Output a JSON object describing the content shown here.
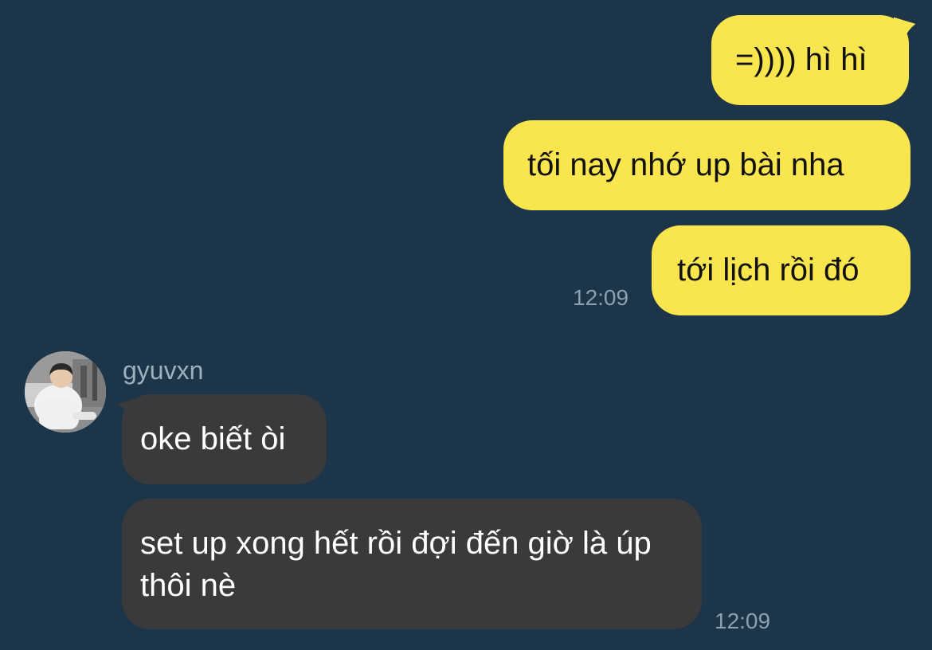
{
  "colors": {
    "background": "#1d3549",
    "outgoing_bubble": "#f9e54e",
    "incoming_bubble": "#3a3a3c",
    "timestamp": "#8ea0ae",
    "sender_name": "#9fb0bd"
  },
  "outgoing": {
    "messages": [
      {
        "text": "=)))) hì hì"
      },
      {
        "text": "tối nay nhớ up bài nha"
      },
      {
        "text": "tới lịch rồi đó"
      }
    ],
    "time": "12:09"
  },
  "incoming": {
    "sender": "gyuvxn",
    "avatar_icon": "profile-photo",
    "messages": [
      {
        "text": "oke biết òi"
      },
      {
        "text": "set up xong hết rồi đợi đến giờ là úp thôi nè"
      }
    ],
    "time": "12:09"
  }
}
